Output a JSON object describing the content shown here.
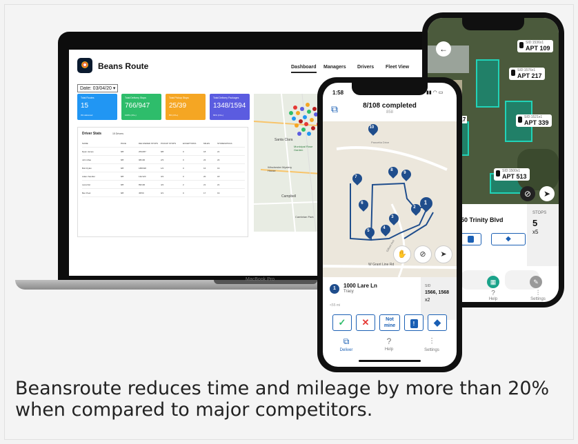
{
  "caption": "Beansroute reduces time and mileage by more than 20% when compared to major competitors.",
  "laptop": {
    "label": "MacBook Pro",
    "brand": "Beans Route",
    "nav": [
      "Dashboard",
      "Managers",
      "Drivers",
      "Fleet View"
    ],
    "date_select": "Date: 03/04/20 ▾",
    "cards": [
      {
        "label": "Total Routes",
        "value": "15",
        "sub": "0% delivered",
        "color": "#2196f3"
      },
      {
        "label": "Total Delivery Stops",
        "value": "766/947",
        "sub": "100% (1%+)",
        "color": "#2ebd6b"
      },
      {
        "label": "Total Pickup Stops",
        "value": "25/39",
        "sub": "8% (1%+)",
        "color": "#f5a623"
      },
      {
        "label": "Total Delivery Packages",
        "value": "1348/1594",
        "sub": "83% (1%+)",
        "color": "#5b5ce0"
      }
    ],
    "driver_stats": {
      "title": "Driver Stats",
      "subtitle": "15 Drivers",
      "headers": [
        "NAME",
        "PACE",
        "DELIVERED STOPS",
        "PICKUP STOPS",
        "EXCEPTIONS",
        "MILES",
        "STORES/PKGS"
      ],
      "rows": [
        [
          "Ryan James",
          "8/8",
          "253/257",
          "8/8",
          "0",
          "18",
          "21"
        ],
        [
          "John Mao",
          "8/8",
          "98/100",
          "2/3",
          "0",
          "23",
          "23"
        ],
        [
          "Bob Dylan",
          "8/8",
          "188/198",
          "1/2",
          "0",
          "16",
          "19"
        ],
        [
          "Adam Sandler",
          "8/8",
          "111/120",
          "3/4",
          "0",
          "20",
          "18"
        ],
        [
          "Lana Del",
          "8/8",
          "89/100",
          "4/4",
          "2",
          "21",
          "21"
        ],
        [
          "Ben Paul",
          "8/8",
          "45/50",
          "0/1",
          "0",
          "17",
          "19"
        ]
      ]
    },
    "map_labels": [
      "Santa Clara",
      "Municipal Rose Garden",
      "Winchester Mystery House",
      "Campbell",
      "Cambrian Park"
    ]
  },
  "back_phone": {
    "apt_tags": [
      {
        "sid": "SID:1536x1",
        "apt": "APT 109"
      },
      {
        "sid": "SID:1576x1",
        "apt": "APT 217"
      },
      {
        "sid": "SID:1521x1",
        "apt": "APT 339"
      },
      {
        "sid": "SID:1500x1",
        "apt": "APT 513"
      }
    ],
    "partial_label": "317",
    "address": "50 Trinity Blvd",
    "stops_label": "STOPS",
    "stops_value": "5",
    "stops_multiplier": "x5",
    "tabs": [
      "Help",
      "Settings"
    ]
  },
  "front_phone": {
    "time": "1:58",
    "progress": "8/108 completed",
    "progress_sub": "858",
    "map_pins": [
      "10",
      "8",
      "9",
      "7",
      "6",
      "1",
      "2",
      "3",
      "4",
      "5"
    ],
    "street_labels": [
      "Pancetta Drive",
      "W Grant Line Rd",
      "Gilbert Ave"
    ],
    "stop_number": "1",
    "address": "1000 Lare Ln",
    "city": "Tracy",
    "distance": "<55 mi",
    "sid_label": "SID",
    "sid_value": "1566, 1568",
    "sid_multiplier": "x2",
    "actions": [
      "✓",
      "✕",
      "Not mine",
      "!",
      "◆"
    ],
    "tabs": [
      "Deliver",
      "Help",
      "Settings"
    ]
  },
  "colors": {
    "brand_blue": "#1a5fb4",
    "teal": "#21d3b8",
    "green": "#2ebd6b",
    "red": "#e53935"
  }
}
